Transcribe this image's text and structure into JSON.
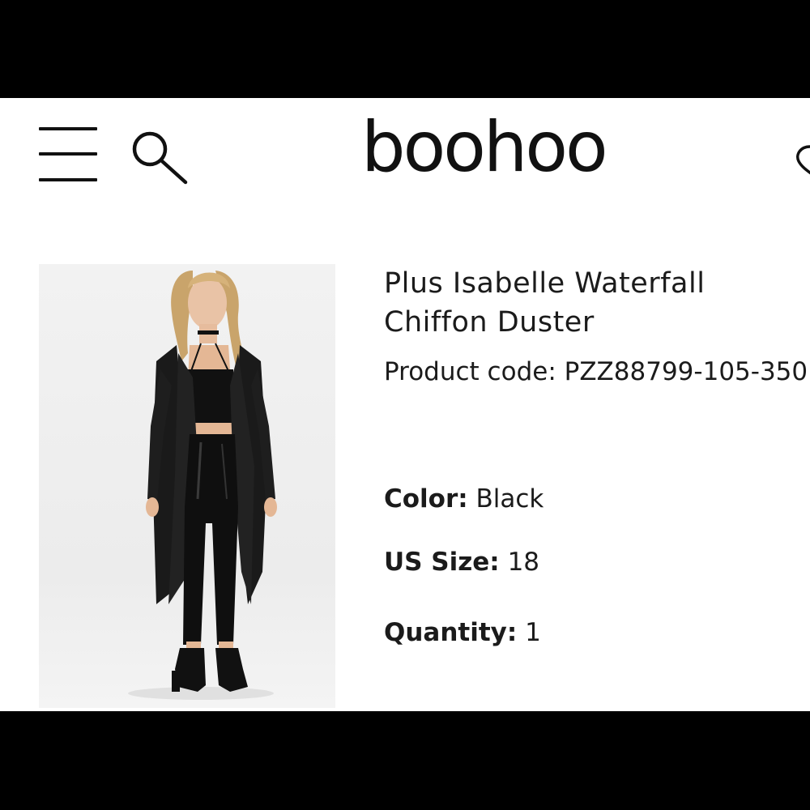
{
  "header": {
    "logo_text": "boohoo",
    "icons": [
      "menu-icon",
      "search-icon",
      "wishlist-icon"
    ]
  },
  "product": {
    "title": "Plus Isabelle Waterfall Chiffon Duster",
    "code_label": "Product code:",
    "code_value": "PZZ88799-105-350",
    "color_label": "Color:",
    "color_value": "Black",
    "size_label": "US Size:",
    "size_value": "18",
    "quantity_label": "Quantity:",
    "quantity_value": "1"
  },
  "colors": {
    "text": "#1b1b1b",
    "background": "#ffffff",
    "letterbox": "#000000"
  }
}
